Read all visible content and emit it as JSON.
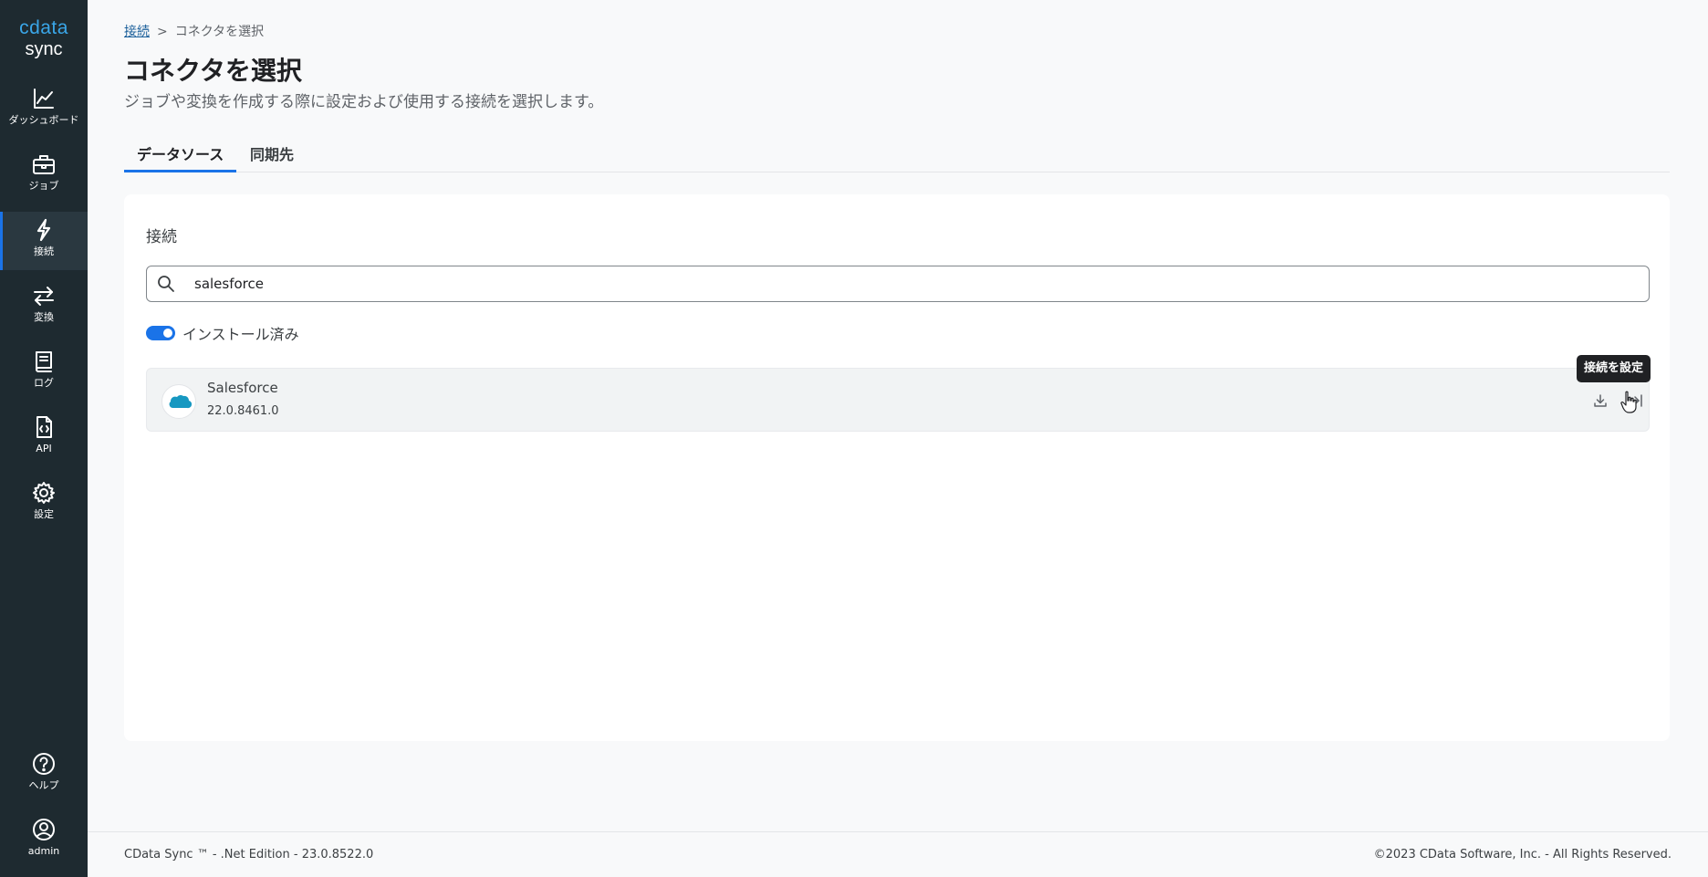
{
  "app": {
    "logo_top": "cdata",
    "logo_bottom": "sync"
  },
  "sidebar": {
    "items": [
      {
        "label": "ダッシュボード",
        "icon": "chart-line-icon"
      },
      {
        "label": "ジョブ",
        "icon": "briefcase-icon"
      },
      {
        "label": "接続",
        "icon": "lightning-icon",
        "active": true
      },
      {
        "label": "変換",
        "icon": "swap-arrows-icon"
      },
      {
        "label": "ログ",
        "icon": "book-icon"
      },
      {
        "label": "API",
        "icon": "code-file-icon"
      },
      {
        "label": "設定",
        "icon": "gear-icon"
      }
    ],
    "bottom": [
      {
        "label": "ヘルプ",
        "icon": "help-icon"
      },
      {
        "label": "admin",
        "icon": "user-icon"
      }
    ]
  },
  "breadcrumb": {
    "link": "接続",
    "separator": ">",
    "current": "コネクタを選択"
  },
  "page": {
    "title": "コネクタを選択",
    "subtitle": "ジョブや変換を作成する際に設定および使用する接続を選択します。"
  },
  "tabs": [
    {
      "label": "データソース",
      "active": true
    },
    {
      "label": "同期先",
      "active": false
    }
  ],
  "card": {
    "title": "接続",
    "search_value": "salesforce",
    "toggle_label": "インストール済み",
    "toggle_on": true
  },
  "connectors": [
    {
      "name": "Salesforce",
      "version": "22.0.8461.0",
      "logo_text": "salesforce"
    }
  ],
  "tooltip": "接続を設定",
  "footer": {
    "left": "CData Sync ™ - .Net Edition - 23.0.8522.0",
    "right": "©2023 CData Software, Inc. - All Rights Reserved."
  },
  "colors": {
    "sidebar_bg": "#1e2a30",
    "accent": "#1a73e8",
    "logo_blue": "#3aa6e8",
    "salesforce_blue": "#1798c1"
  }
}
